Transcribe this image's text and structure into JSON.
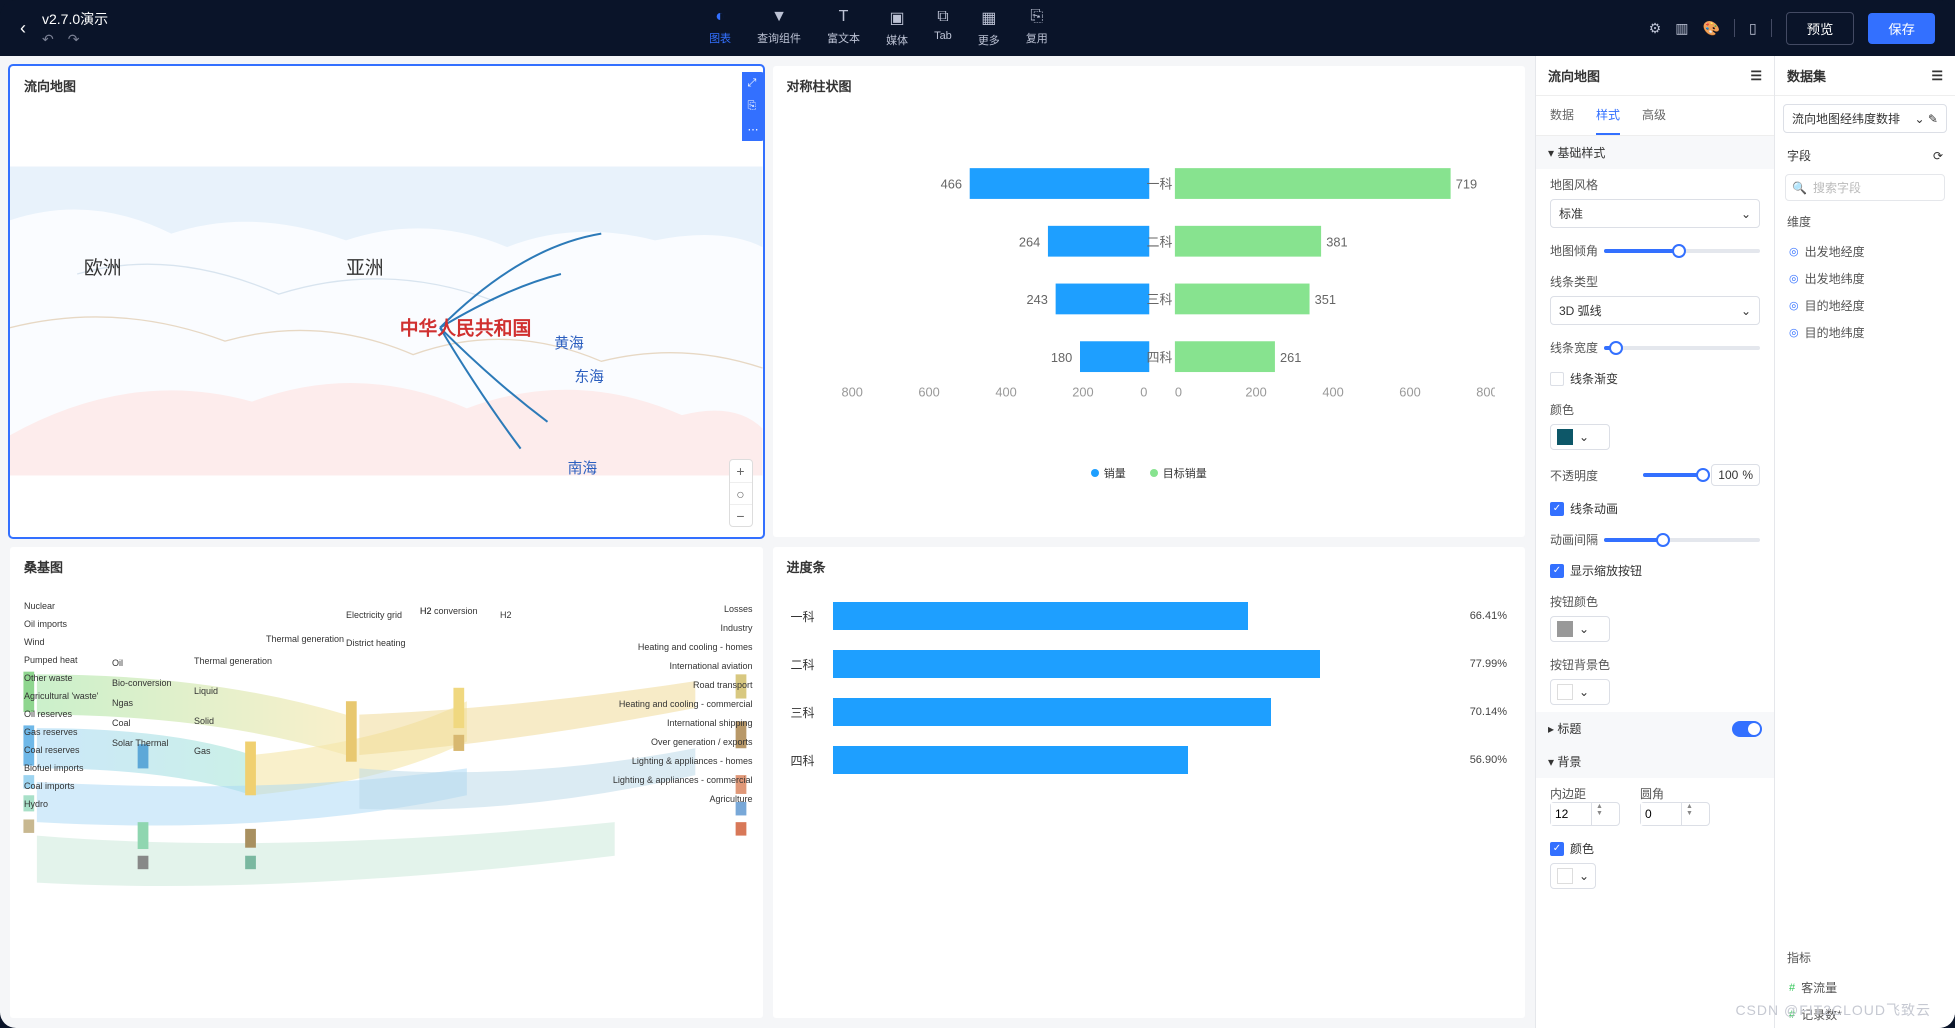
{
  "header": {
    "title": "v2.7.0演示",
    "tools": [
      {
        "label": "图表",
        "active": true
      },
      {
        "label": "查询组件"
      },
      {
        "label": "富文本"
      },
      {
        "label": "媒体"
      },
      {
        "label": "Tab"
      },
      {
        "label": "更多"
      },
      {
        "label": "复用"
      }
    ],
    "preview": "预览",
    "save": "保存"
  },
  "panels": {
    "map": {
      "title": "流向地图",
      "labels": {
        "europe": "欧洲",
        "asia": "亚洲",
        "china": "中华人民共和国",
        "yellow": "黄海",
        "east": "东海",
        "south": "南海"
      }
    },
    "barchart": {
      "title": "对称柱状图",
      "legend": {
        "a": "销量",
        "b": "目标销量"
      }
    },
    "sankey": {
      "title": "桑基图"
    },
    "progress": {
      "title": "进度条"
    }
  },
  "chart_data": [
    {
      "type": "bar",
      "subtype": "diverging",
      "title": "对称柱状图",
      "categories": [
        "一科",
        "二科",
        "三科",
        "四科"
      ],
      "series": [
        {
          "name": "销量",
          "values": [
            466,
            264,
            243,
            180
          ]
        },
        {
          "name": "目标销量",
          "values": [
            719,
            381,
            351,
            261
          ]
        }
      ],
      "xlim": [
        -800,
        800
      ],
      "xticks": [
        800,
        600,
        400,
        200,
        0,
        0,
        200,
        400,
        600,
        800
      ]
    },
    {
      "type": "bar",
      "subtype": "progress",
      "title": "进度条",
      "categories": [
        "一科",
        "二科",
        "三科",
        "四科"
      ],
      "values": [
        66.41,
        77.99,
        70.14,
        56.9
      ],
      "unit": "%"
    }
  ],
  "sankey_nodes_left": [
    "Nuclear",
    "Oil imports",
    "Wind",
    "Pumped heat",
    "Other waste",
    "Agricultural 'waste'",
    "Oil reserves",
    "Gas reserves",
    "Coal reserves",
    "Biofuel imports",
    "Coal imports",
    "Hydro"
  ],
  "sankey_nodes_mid1": [
    "Oil",
    "Bio-conversion",
    "Ngas",
    "Coal",
    "Solar Thermal"
  ],
  "sankey_nodes_mid2": [
    "Thermal generation",
    "Liquid",
    "Solid",
    "Gas"
  ],
  "sankey_nodes_mid3": [
    "Electricity grid",
    "District heating"
  ],
  "sankey_nodes_mid4": [
    "H2 conversion",
    "H2"
  ],
  "sankey_nodes_right": [
    "Losses",
    "Industry",
    "Heating and cooling - homes",
    "International aviation",
    "Road transport",
    "Heating and cooling - commercial",
    "International shipping",
    "Over generation / exports",
    "Lighting & appliances - homes",
    "Lighting & appliances - commercial",
    "Agriculture"
  ],
  "props": {
    "header": "流向地图",
    "tabs": {
      "data": "数据",
      "style": "样式",
      "advanced": "高级"
    },
    "group_basic": "基础样式",
    "map_style_label": "地图风格",
    "map_style_value": "标准",
    "map_pitch": "地图倾角",
    "line_type_label": "线条类型",
    "line_type_value": "3D 弧线",
    "line_width": "线条宽度",
    "line_gradient": "线条渐变",
    "color_label": "颜色",
    "color_value": "#0d5768",
    "opacity_label": "不透明度",
    "opacity_value": "100",
    "opacity_unit": "%",
    "line_anim": "线条动画",
    "anim_interval": "动画间隔",
    "show_zoom": "显示缩放按钮",
    "btn_color": "按钮颜色",
    "btn_bg": "按钮背景色",
    "group_title": "标题",
    "group_bg": "背景",
    "padding_label": "内边距",
    "padding_value": "12",
    "radius_label": "圆角",
    "radius_value": "0",
    "bg_color_label": "颜色"
  },
  "datasets": {
    "header": "数据集",
    "selected": "流向地图经纬度数排",
    "field_label": "字段",
    "search_ph": "搜索字段",
    "dim_label": "维度",
    "dims": [
      "出发地经度",
      "出发地纬度",
      "目的地经度",
      "目的地纬度"
    ],
    "metric_label": "指标",
    "metrics": [
      "客流量",
      "记录数*"
    ]
  },
  "watermark": "CSDN @FIT2CLOUD飞致云"
}
